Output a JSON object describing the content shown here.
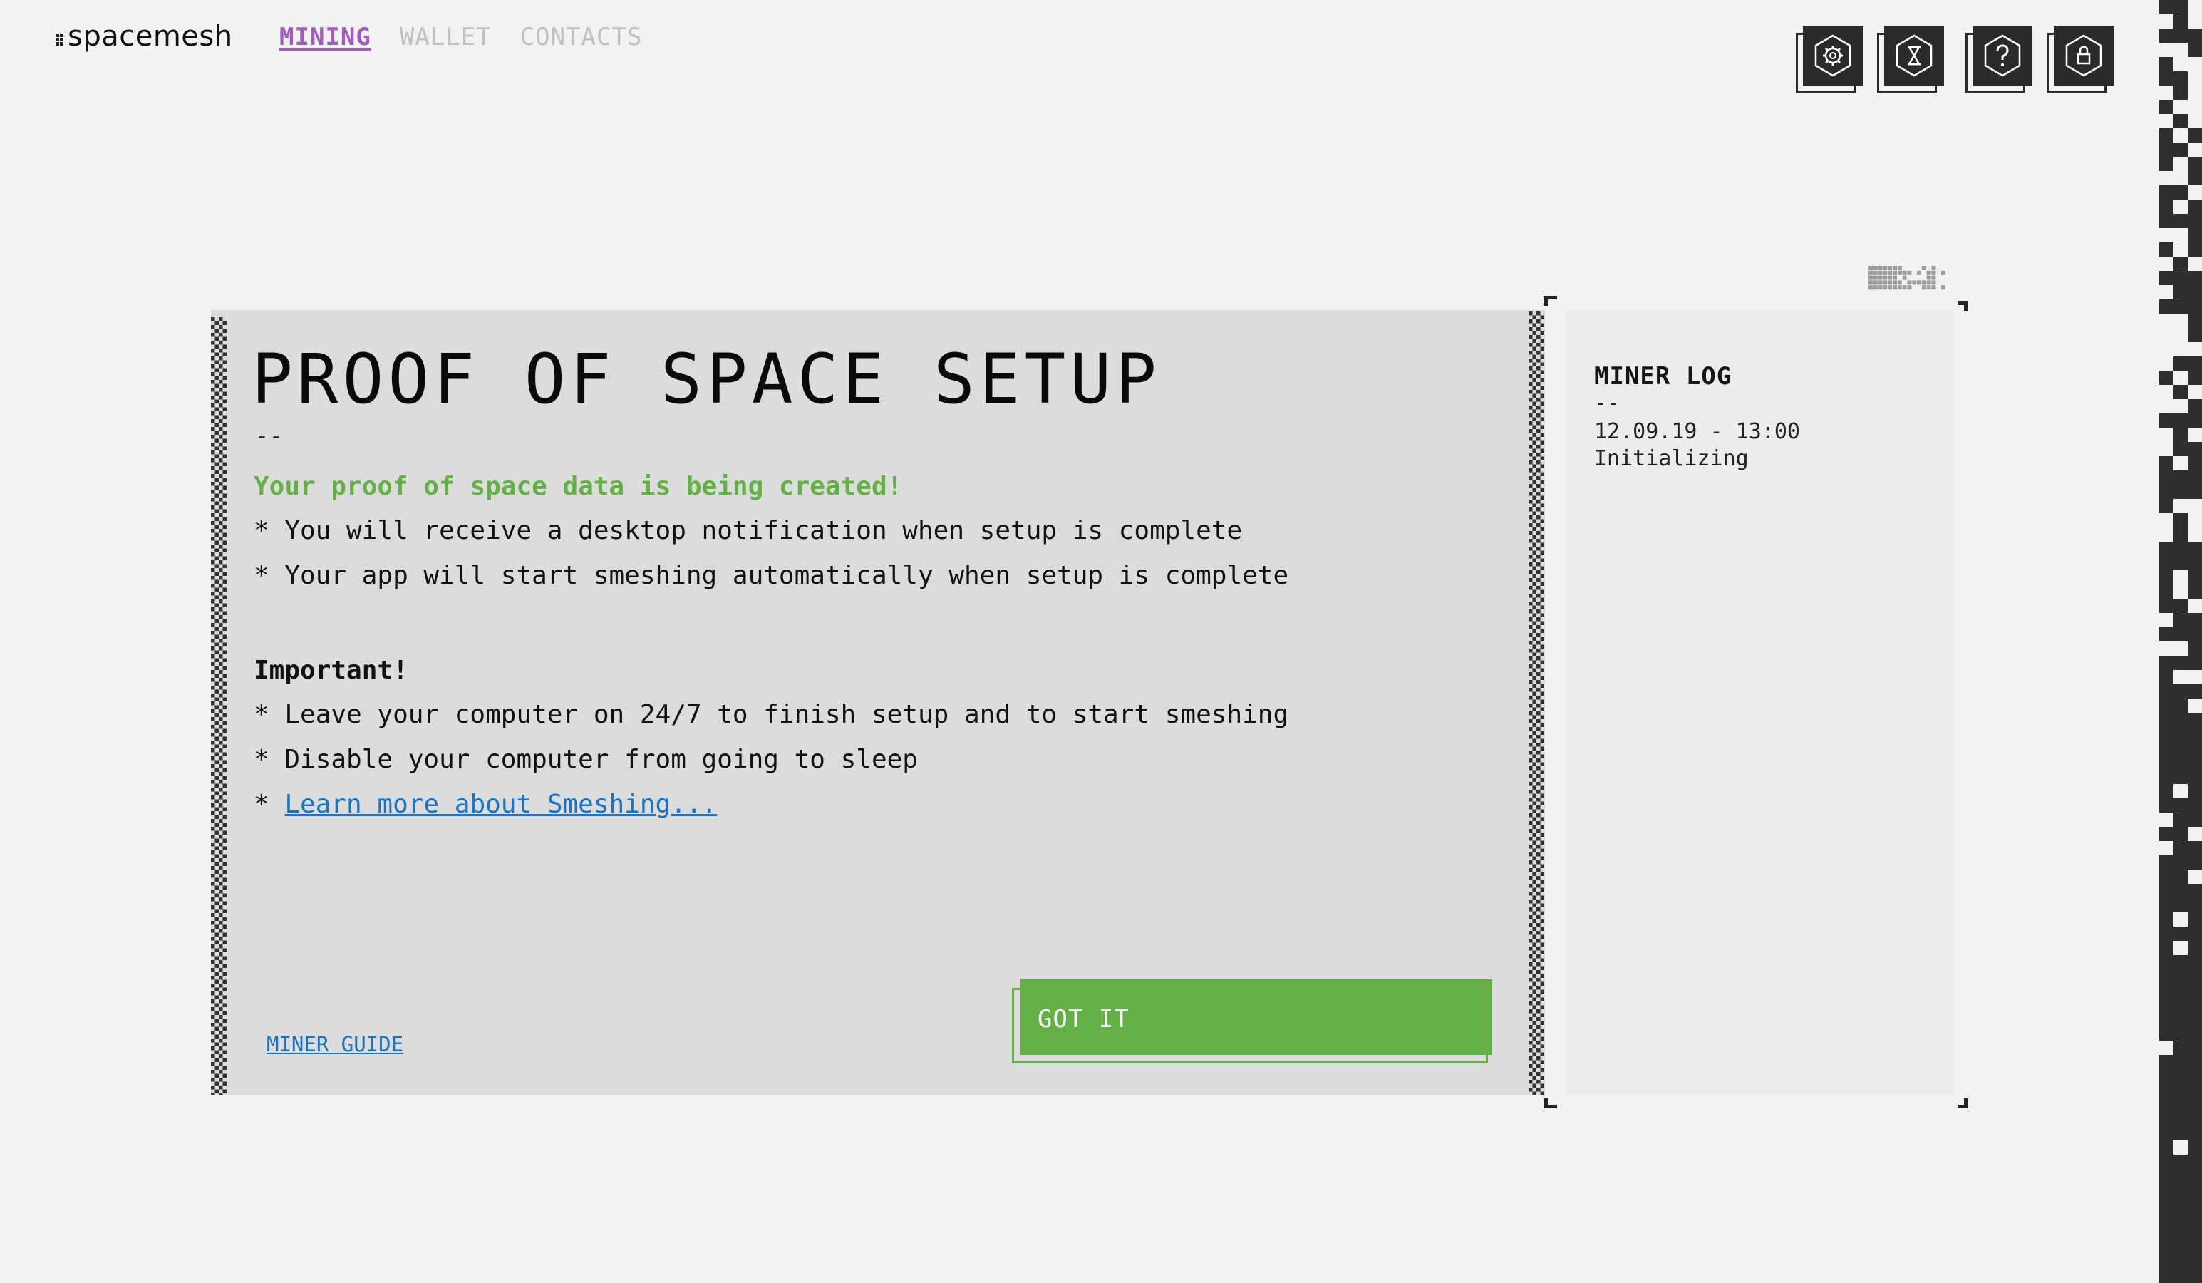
{
  "app": {
    "logo_text": "spacemesh",
    "accent_color": "#a35bbf",
    "success_color": "#64b047",
    "link_color": "#1b74c2"
  },
  "nav": {
    "items": [
      {
        "label": "MINING",
        "active": true
      },
      {
        "label": "WALLET",
        "active": false
      },
      {
        "label": "CONTACTS",
        "active": false
      }
    ]
  },
  "toolbar": {
    "icons": [
      "settings-icon",
      "hourglass-icon",
      "help-icon",
      "lock-icon"
    ]
  },
  "setup": {
    "title": "PROOF OF SPACE SETUP",
    "divider": "--",
    "headline": "Your proof of space data is being created!",
    "bullets": [
      "* You will receive a desktop notification when setup is complete",
      "* Your app will start smeshing automatically when setup is complete"
    ],
    "important_heading": "Important!",
    "important_bullets": [
      "* Leave your computer on 24/7 to finish setup and to start smeshing",
      "* Disable your computer from going to sleep"
    ],
    "learn_more_prefix": "* ",
    "learn_more_link": "Learn more about Smeshing...",
    "miner_guide_link": "MINER GUIDE",
    "got_it_button": "GOT IT"
  },
  "miner_log": {
    "title": "MINER LOG",
    "divider": "--",
    "entries": [
      {
        "time": "12.09.19 - 13:00",
        "status": "Initializing"
      }
    ]
  }
}
